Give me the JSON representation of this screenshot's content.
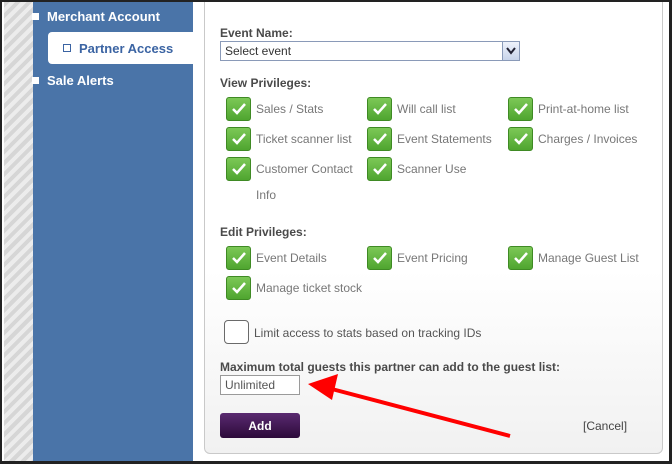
{
  "sidebar": {
    "items": [
      {
        "label": "Merchant Account"
      },
      {
        "label": "Partner Access",
        "active": true
      },
      {
        "label": "Sale Alerts"
      }
    ]
  },
  "form": {
    "event_name_label": "Event Name:",
    "event_select_value": "Select event",
    "view_privileges_label": "View Privileges:",
    "view_privileges": [
      {
        "label": "Sales / Stats",
        "checked": true
      },
      {
        "label": "Will call list",
        "checked": true
      },
      {
        "label": "Print-at-home list",
        "checked": true
      },
      {
        "label": "Ticket scanner list",
        "checked": true
      },
      {
        "label": "Event Statements",
        "checked": true
      },
      {
        "label": "Charges / Invoices",
        "checked": true
      },
      {
        "label": "Customer Contact",
        "label_line2": "Info",
        "checked": true
      },
      {
        "label": "Scanner Use",
        "checked": true
      }
    ],
    "edit_privileges_label": "Edit Privileges:",
    "edit_privileges": [
      {
        "label": "Event Details",
        "checked": true
      },
      {
        "label": "Event Pricing",
        "checked": true
      },
      {
        "label": "Manage Guest List",
        "checked": true
      },
      {
        "label": "Manage ticket stock",
        "checked": true
      }
    ],
    "limit_access": {
      "label": "Limit access to stats based on tracking IDs",
      "checked": false
    },
    "max_guests_label": "Maximum total guests this partner can add to the guest list:",
    "max_guests_value": "Unlimited",
    "add_button": "Add",
    "cancel_link": "[Cancel]"
  },
  "colors": {
    "sidebar": "#4a74a8",
    "checkbox_green": "#5cb13a",
    "add_button": "#3b0f4d",
    "annotation_arrow": "#ff0000"
  }
}
